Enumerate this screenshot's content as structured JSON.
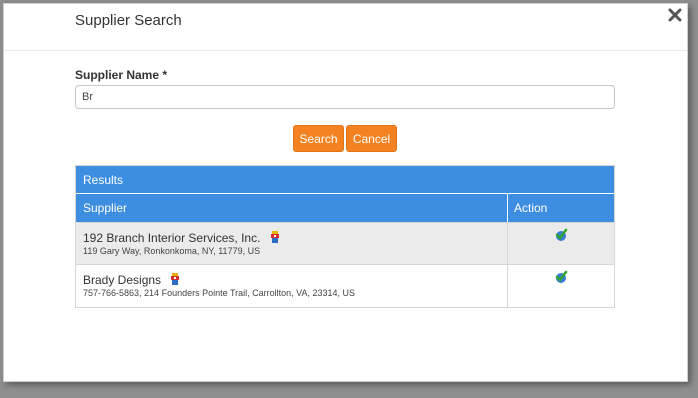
{
  "dialog": {
    "title": "Supplier Search",
    "close_icon": "close-icon"
  },
  "form": {
    "supplier_name_label": "Supplier Name *",
    "supplier_name_value": "Br",
    "search_label": "Search",
    "cancel_label": "Cancel"
  },
  "results": {
    "title": "Results",
    "columns": [
      "Supplier",
      "Action"
    ],
    "rows": [
      {
        "name": "192 Branch Interior Services, Inc.",
        "address": "119 Gary Way, Ronkonkoma, NY, 11779, US",
        "badge_icon": "diversity-badge-icon",
        "action_icon": "select-checkmark-icon"
      },
      {
        "name": "Brady Designs",
        "address": "757-766-5863, 214 Founders Pointe Trail, Carrollton, VA, 23314, US",
        "badge_icon": "diversity-badge-icon",
        "action_icon": "select-checkmark-icon"
      }
    ]
  },
  "colors": {
    "accent_orange": "#f58220",
    "header_blue": "#3d8de0",
    "row_alt": "#ebebeb"
  }
}
